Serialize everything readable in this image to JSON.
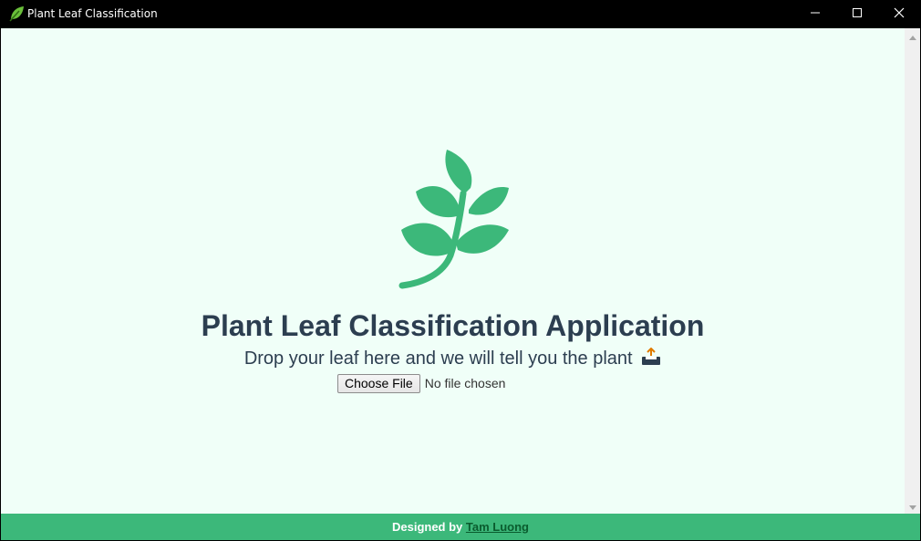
{
  "window": {
    "title": "Plant Leaf Classification",
    "app_icon": "leaf-icon",
    "controls": [
      "minimize-icon",
      "maximize-icon",
      "close-icon"
    ]
  },
  "main": {
    "logo_icon": "plant-sprout-icon",
    "title": "Plant Leaf Classification Application",
    "subtitle": "Drop your leaf here and we will tell you the plant",
    "subtitle_icon": "inbox-tray-icon",
    "file_input": {
      "button_label": "Choose File",
      "status": "No file chosen"
    }
  },
  "footer": {
    "prefix": "Designed by",
    "author": "Tam Luong"
  },
  "colors": {
    "accent": "#3cb87a",
    "background": "#f0fff8",
    "text": "#2c3e50",
    "footer_link": "#0a5c2e"
  }
}
